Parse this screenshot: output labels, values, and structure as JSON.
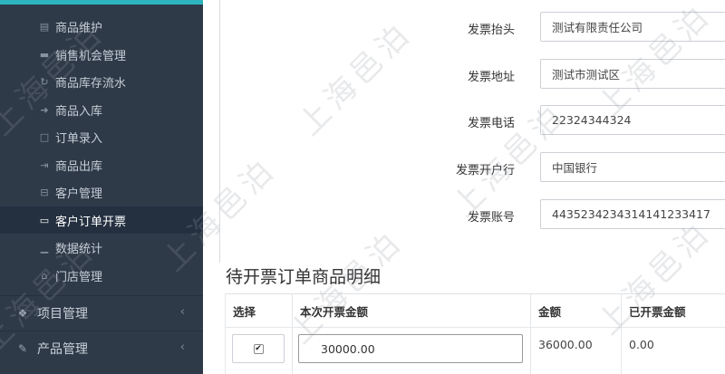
{
  "sidebar": {
    "sub_items": [
      {
        "label": "商品维护",
        "icon": "stack-icon"
      },
      {
        "label": "销售机会管理",
        "icon": "chart-icon"
      },
      {
        "label": "商品库存流水",
        "icon": "refresh-icon"
      },
      {
        "label": "商品入库",
        "icon": "sign-in-icon"
      },
      {
        "label": "订单录入",
        "icon": "bookmark-icon"
      },
      {
        "label": "商品出库",
        "icon": "sign-out-icon"
      },
      {
        "label": "客户管理",
        "icon": "user-card-icon"
      },
      {
        "label": "客户订单开票",
        "icon": "credit-card-icon"
      },
      {
        "label": "数据统计",
        "icon": "area-chart-icon"
      },
      {
        "label": "门店管理",
        "icon": "store-icon"
      }
    ],
    "top_items": [
      {
        "label": "项目管理",
        "icon": "cubes-icon"
      },
      {
        "label": "产品管理",
        "icon": "edit-icon"
      }
    ],
    "active_index": 7
  },
  "form": {
    "fields": [
      {
        "label": "发票抬头",
        "value": "测试有限责任公司"
      },
      {
        "label": "发票地址",
        "value": "测试市测试区"
      },
      {
        "label": "发票电话",
        "value": "22324344324"
      },
      {
        "label": "发票开户行",
        "value": "中国银行"
      },
      {
        "label": "发票账号",
        "value": "4435234234314141233417"
      }
    ]
  },
  "section": {
    "title": "待开票订单商品明细"
  },
  "table": {
    "headers": [
      "选择",
      "本次开票金额",
      "金额",
      "已开票金额"
    ],
    "row": {
      "checked": true,
      "check_mark": "✔",
      "this_amount": "30000.00",
      "amount": "36000.00",
      "invoiced": "0.00"
    }
  },
  "watermark": {
    "text": "上海邑泊"
  }
}
